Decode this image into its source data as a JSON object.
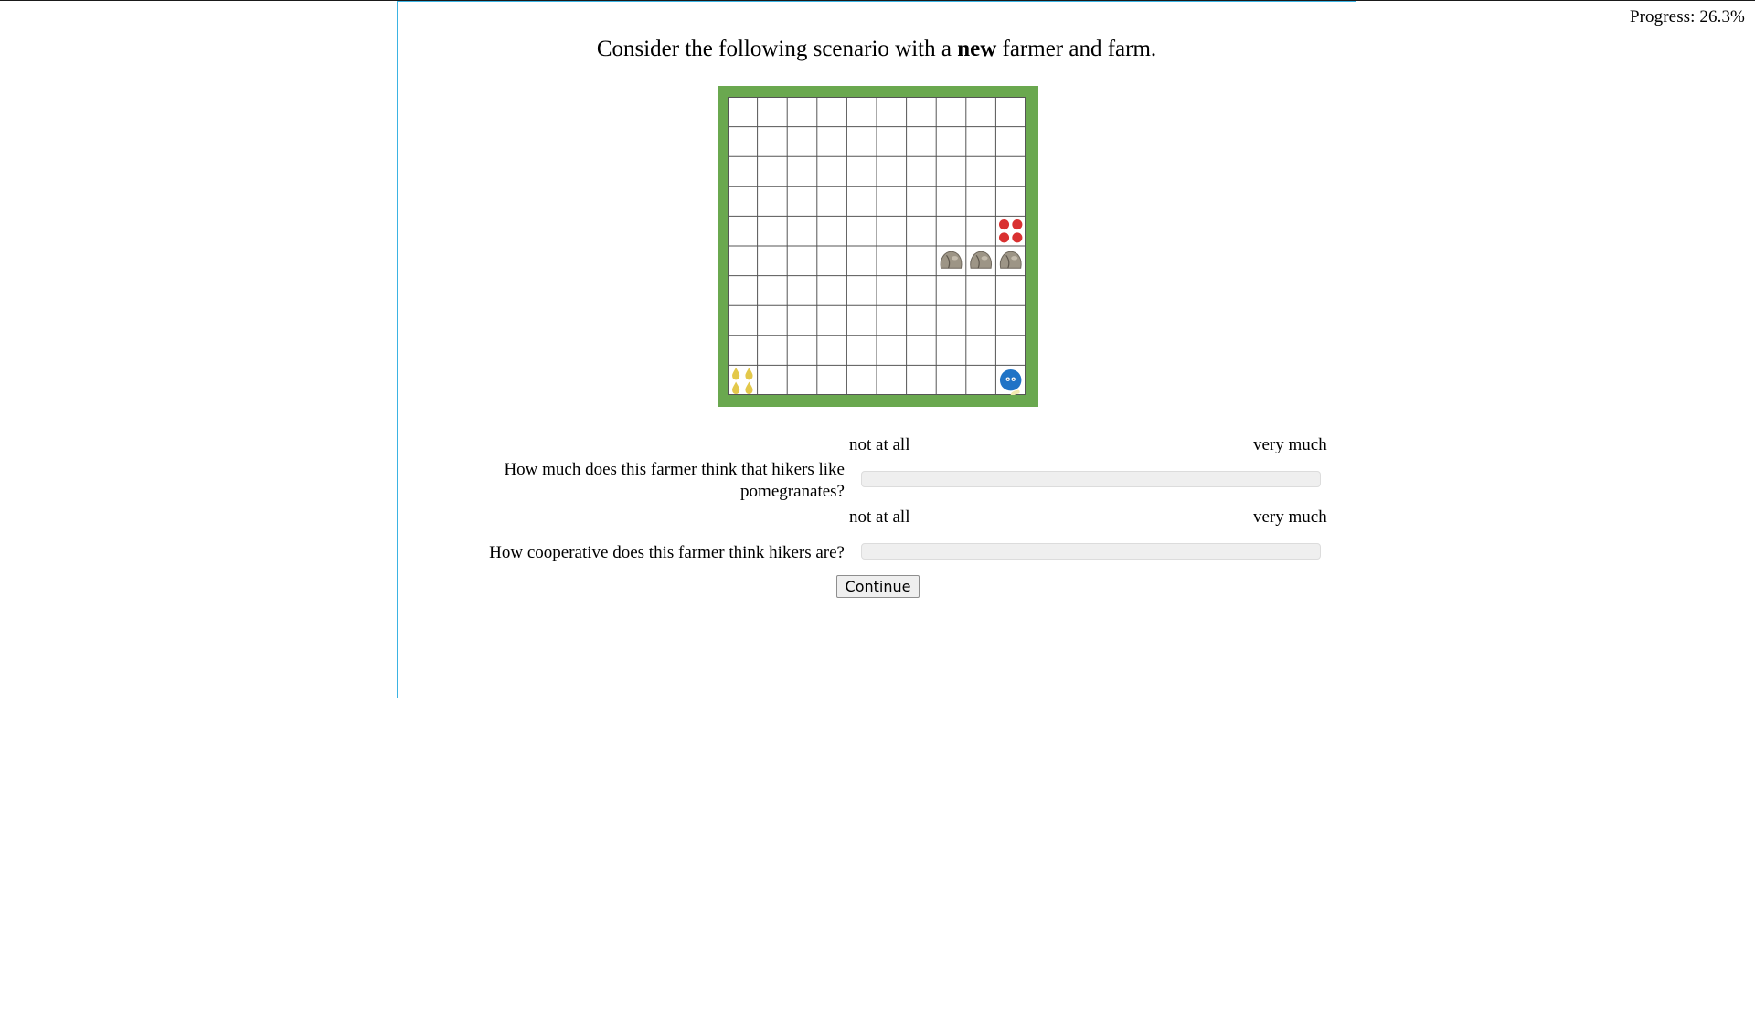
{
  "progress": {
    "label": "Progress: 26.3%"
  },
  "title": {
    "prefix": "Consider the following scenario with a ",
    "emphasis": "new",
    "suffix": " farmer and farm."
  },
  "farm": {
    "rows": 10,
    "cols": 10,
    "border_color": "#6aa84f",
    "objects": [
      {
        "type": "pomegranates-icon",
        "row": 5,
        "col": 10
      },
      {
        "type": "rock-icon",
        "row": 6,
        "col": 8
      },
      {
        "type": "rock-icon",
        "row": 6,
        "col": 9
      },
      {
        "type": "rock-icon",
        "row": 6,
        "col": 10
      },
      {
        "type": "pears-icon",
        "row": 10,
        "col": 1
      },
      {
        "type": "hiker-icon",
        "row": 10,
        "col": 10
      }
    ]
  },
  "questions": [
    {
      "low_label": "not at all",
      "high_label": "very much",
      "text": "How much does this farmer think that hikers like pomegranates?"
    },
    {
      "low_label": "not at all",
      "high_label": "very much",
      "text": "How cooperative does this farmer think hikers are?"
    }
  ],
  "continue_label": "Continue",
  "colors": {
    "panel_border": "#3bb3e3",
    "pomegranate": "#d93030",
    "pear": "#e3c84a",
    "hiker": "#1f73c6"
  }
}
